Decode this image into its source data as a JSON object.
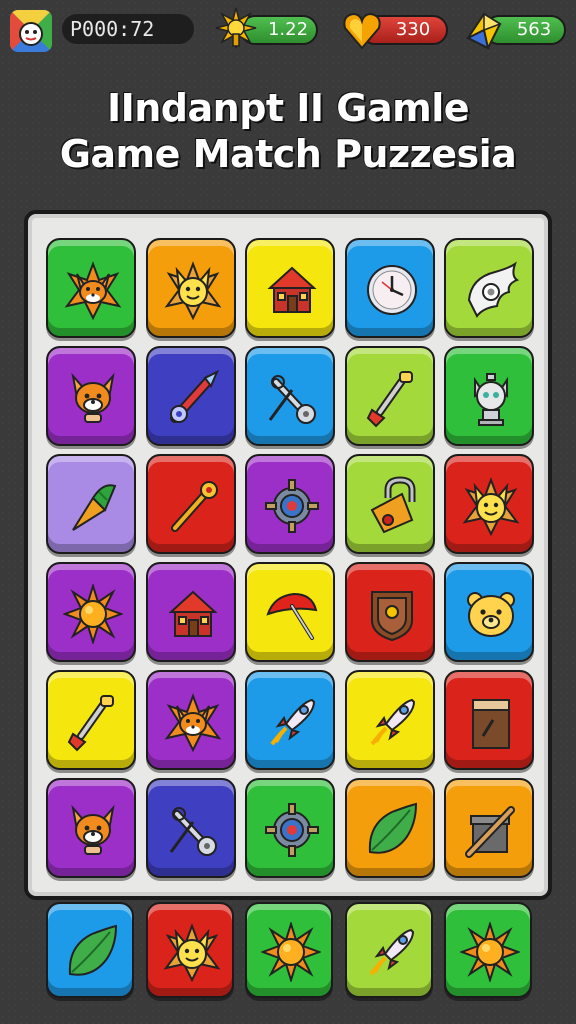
{
  "hud": {
    "timer": "P000:72",
    "power": "1.22",
    "hearts": "330",
    "gems": "563"
  },
  "title": {
    "line1": "IIndanpt II Gamle",
    "line2": "Game Match Puzzesia"
  },
  "colors": {
    "green": "#2fbf3a",
    "orange": "#f59e0b",
    "yellow": "#f5e60e",
    "blue": "#1e9be8",
    "lime": "#a3d93a",
    "purple": "#9d2fc9",
    "indigo": "#3f3fc2",
    "lavender": "#a98be6",
    "red": "#d9231b"
  },
  "grid": [
    [
      {
        "color": "green",
        "icon": "fox-star-icon"
      },
      {
        "color": "orange",
        "icon": "cat-star-icon"
      },
      {
        "color": "yellow",
        "icon": "house-icon"
      },
      {
        "color": "blue",
        "icon": "clock-icon"
      },
      {
        "color": "lime",
        "icon": "wing-icon"
      }
    ],
    [
      {
        "color": "purple",
        "icon": "fox-head-icon"
      },
      {
        "color": "indigo",
        "icon": "rocket-pen-icon"
      },
      {
        "color": "blue",
        "icon": "wrench-icon"
      },
      {
        "color": "lime",
        "icon": "shovel-icon"
      },
      {
        "color": "green",
        "icon": "cat-statue-icon"
      }
    ],
    [
      {
        "color": "lavender",
        "icon": "carrot-icon"
      },
      {
        "color": "red",
        "icon": "key-icon"
      },
      {
        "color": "purple",
        "icon": "gear-icon"
      },
      {
        "color": "lime",
        "icon": "padlock-icon"
      },
      {
        "color": "red",
        "icon": "cat-star-icon"
      }
    ],
    [
      {
        "color": "purple",
        "icon": "sun-icon"
      },
      {
        "color": "purple",
        "icon": "house-icon"
      },
      {
        "color": "yellow",
        "icon": "umbrella-icon"
      },
      {
        "color": "red",
        "icon": "shield-icon"
      },
      {
        "color": "blue",
        "icon": "bear-icon"
      }
    ],
    [
      {
        "color": "yellow",
        "icon": "shovel-icon"
      },
      {
        "color": "purple",
        "icon": "fox-star-icon"
      },
      {
        "color": "blue",
        "icon": "rocket-icon"
      },
      {
        "color": "yellow",
        "icon": "rocket-icon"
      },
      {
        "color": "red",
        "icon": "sign-box-icon"
      }
    ],
    [
      {
        "color": "purple",
        "icon": "fox-head-icon"
      },
      {
        "color": "indigo",
        "icon": "wrench-icon"
      },
      {
        "color": "green",
        "icon": "gear-icon"
      },
      {
        "color": "orange",
        "icon": "leaf-icon"
      },
      {
        "color": "orange",
        "icon": "box-icon"
      }
    ]
  ],
  "dock": [
    {
      "color": "blue",
      "icon": "leaf-icon"
    },
    {
      "color": "red",
      "icon": "cat-star-icon"
    },
    {
      "color": "green",
      "icon": "sun-icon"
    },
    {
      "color": "lime",
      "icon": "rocket-icon"
    },
    {
      "color": "green",
      "icon": "sun-icon"
    }
  ]
}
